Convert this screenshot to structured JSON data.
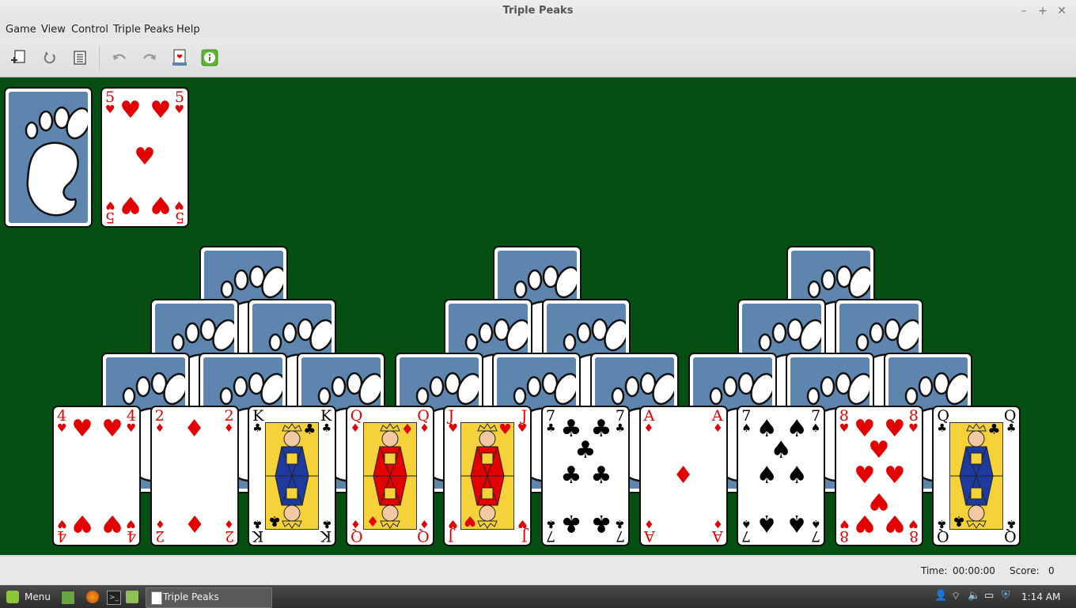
{
  "window": {
    "title": "Triple Peaks"
  },
  "menu": [
    "Game",
    "View",
    "Control",
    "Triple Peaks",
    "Help"
  ],
  "toolbar": {
    "icons": [
      "new-game-icon",
      "restart-icon",
      "select-game-icon",
      "undo-icon",
      "redo-icon",
      "deal-icon",
      "hint-icon"
    ]
  },
  "stock": {
    "face": "back"
  },
  "waste": {
    "rank": "5",
    "suit": "♥",
    "color": "red"
  },
  "peaks": {
    "row1_backs": 3,
    "row2_backs": 6,
    "row3_backs": 9,
    "bottom_row": [
      {
        "rank": "4",
        "suit": "♥",
        "color": "red"
      },
      {
        "rank": "2",
        "suit": "♦",
        "color": "red"
      },
      {
        "rank": "K",
        "suit": "♣",
        "color": "black"
      },
      {
        "rank": "Q",
        "suit": "♦",
        "color": "red"
      },
      {
        "rank": "J",
        "suit": "♥",
        "color": "red"
      },
      {
        "rank": "7",
        "suit": "♣",
        "color": "black"
      },
      {
        "rank": "A",
        "suit": "♦",
        "color": "red"
      },
      {
        "rank": "7",
        "suit": "♠",
        "color": "black"
      },
      {
        "rank": "8",
        "suit": "♥",
        "color": "red"
      },
      {
        "rank": "Q",
        "suit": "♣",
        "color": "black"
      }
    ]
  },
  "status": {
    "time_label": "Time:",
    "time_value": "00:00:00",
    "score_label": "Score:",
    "score_value": "0"
  },
  "taskbar": {
    "menu_label": "Menu",
    "window_button": "Triple Peaks",
    "clock": "1:14 AM"
  },
  "colors": {
    "felt": "#054f13",
    "card_back": "#5d85ae",
    "red_suit": "#e30000"
  }
}
